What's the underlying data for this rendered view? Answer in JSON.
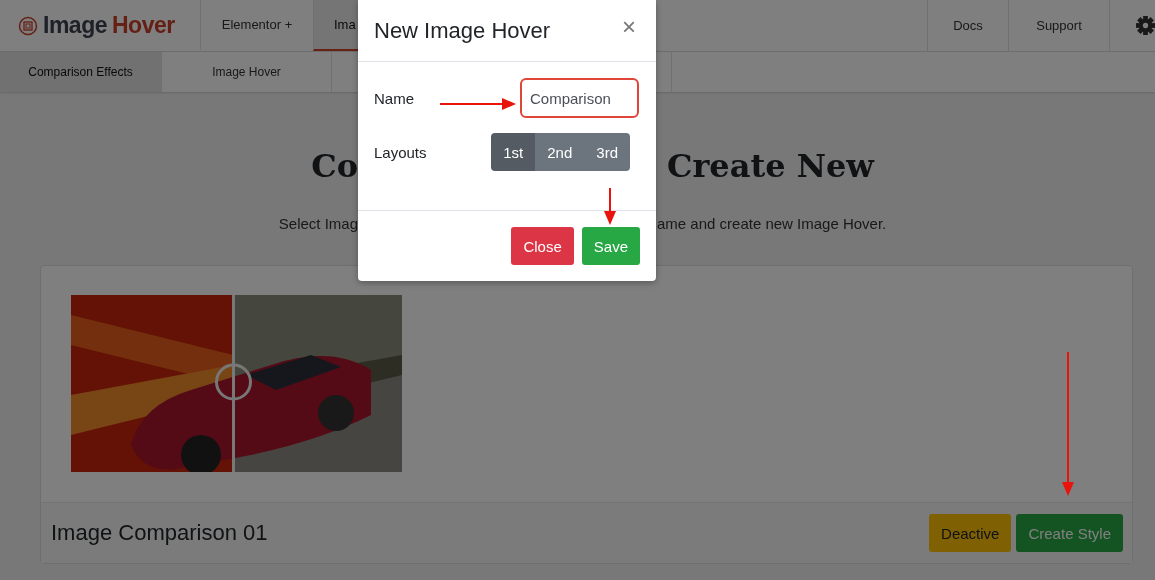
{
  "nav": {
    "logo": {
      "name": "Image",
      "accent": "Hover"
    },
    "tabs": [
      {
        "label": "Elementor +",
        "selected": false
      },
      {
        "label": "Ima",
        "selected": true
      }
    ],
    "links": [
      "Docs",
      "Support"
    ]
  },
  "subnav": {
    "tabs": [
      {
        "label": "Comparison Effects",
        "selected": true
      },
      {
        "label": "Image Hover",
        "selected": false
      }
    ]
  },
  "heading": {
    "left": "Co",
    "right": "Create New"
  },
  "subtitle": {
    "left": "Select Imag",
    "right": "ame and create new Image Hover."
  },
  "cards": [
    {
      "title": "Image Comparison 01",
      "image": {
        "kind": "picture"
      },
      "buttons": [
        {
          "label": "Deactive",
          "kind": "warning"
        },
        {
          "label": "Create Style",
          "kind": "success"
        }
      ]
    }
  ],
  "modal": {
    "title": "New Image Hover",
    "close": "×",
    "fields": [
      {
        "label": "Name",
        "kind": "text",
        "value": "Comparison"
      },
      {
        "label": "Layouts",
        "kind": "segmented",
        "options": [
          {
            "label": "1st",
            "selected": true
          },
          {
            "label": "2nd",
            "selected": false
          },
          {
            "label": "3rd",
            "selected": false
          }
        ]
      }
    ],
    "buttons": [
      {
        "label": "Close",
        "kind": "danger"
      },
      {
        "label": "Save",
        "kind": "success"
      }
    ]
  },
  "annotation_arrows": [
    {
      "kind": "horizontal"
    },
    {
      "kind": "vertical"
    },
    {
      "kind": "vertical"
    }
  ]
}
